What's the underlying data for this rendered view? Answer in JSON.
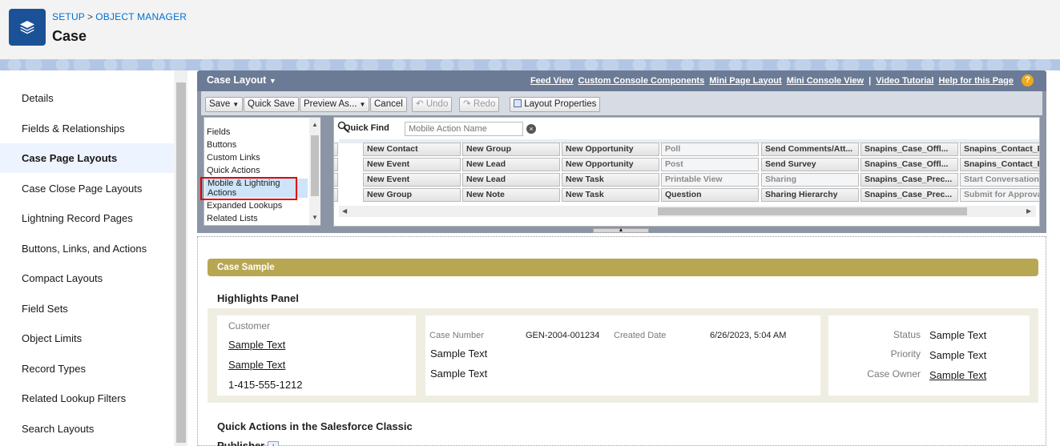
{
  "header": {
    "breadcrumb": [
      "SETUP",
      "OBJECT MANAGER"
    ],
    "breadcrumb_sep": ">",
    "title": "Case",
    "icon": "layers-icon"
  },
  "nav": {
    "items": [
      {
        "label": "Details",
        "active": false
      },
      {
        "label": "Fields & Relationships",
        "active": false
      },
      {
        "label": "Case Page Layouts",
        "active": true
      },
      {
        "label": "Case Close Page Layouts",
        "active": false
      },
      {
        "label": "Lightning Record Pages",
        "active": false
      },
      {
        "label": "Buttons, Links, and Actions",
        "active": false
      },
      {
        "label": "Compact Layouts",
        "active": false
      },
      {
        "label": "Field Sets",
        "active": false
      },
      {
        "label": "Object Limits",
        "active": false
      },
      {
        "label": "Record Types",
        "active": false
      },
      {
        "label": "Related Lookup Filters",
        "active": false
      },
      {
        "label": "Search Layouts",
        "active": false
      }
    ]
  },
  "editor": {
    "title": "Case Layout",
    "links": [
      "Feed View",
      "Custom Console Components",
      "Mini Page Layout",
      "Mini Console View",
      "Video Tutorial",
      "Help for this Page"
    ],
    "link_sep": "|",
    "help_glyph": "?",
    "toolbar": {
      "save": "Save",
      "quick_save": "Quick Save",
      "preview_as": "Preview As...",
      "cancel": "Cancel",
      "undo": "Undo",
      "redo": "Redo",
      "layout_properties": "Layout Properties"
    },
    "categories": [
      "Fields",
      "Buttons",
      "Custom Links",
      "Quick Actions",
      "Mobile & Lightning Actions",
      "Expanded Lookups",
      "Related Lists"
    ],
    "selected_category": "Mobile & Lightning Actions",
    "quick_find": {
      "label": "Quick Find",
      "placeholder": "Mobile Action Name"
    },
    "palette_rows": [
      [
        "",
        "New Contact",
        "New Group",
        "New Opportunity",
        "Poll",
        "Send Comments/Att...",
        "Snapins_Case_Offl...",
        "Snapins_Contact_F"
      ],
      [
        "",
        "New Event",
        "New Lead",
        "New Opportunity",
        "Post",
        "Send Survey",
        "Snapins_Case_Offl...",
        "Snapins_Contact_F"
      ],
      [
        "se",
        "New Event",
        "New Lead",
        "New Task",
        "Printable View",
        "Sharing",
        "Snapins_Case_Prec...",
        "Start Conversation"
      ],
      [
        "",
        "New Group",
        "New Note",
        "New Task",
        "Question",
        "Sharing Hierarchy",
        "Snapins_Case_Prec...",
        "Submit for Approva"
      ]
    ],
    "used_cells": [
      "0-4",
      "1-4",
      "2-4",
      "2-5",
      "2-7",
      "3-7"
    ]
  },
  "canvas": {
    "section_title": "Case Sample",
    "highlights_title": "Highlights Panel",
    "left_card": {
      "label": "Customer",
      "values": [
        "Sample Text",
        "Sample Text",
        "1-415-555-1212"
      ]
    },
    "middle_card": {
      "case_number_label": "Case Number",
      "case_number": "GEN-2004-001234",
      "created_label": "Created Date",
      "created": "6/26/2023, 5:04 AM",
      "values": [
        "Sample Text",
        "Sample Text"
      ]
    },
    "right_card": {
      "rows": [
        {
          "label": "Status",
          "value": "Sample Text",
          "link": false
        },
        {
          "label": "Priority",
          "value": "Sample Text",
          "link": false
        },
        {
          "label": "Case Owner",
          "value": "Sample Text",
          "link": true
        }
      ]
    },
    "quick_actions_title": "Quick Actions in the Salesforce Classic",
    "quick_actions_title2": "Publisher",
    "info_glyph": "i"
  }
}
